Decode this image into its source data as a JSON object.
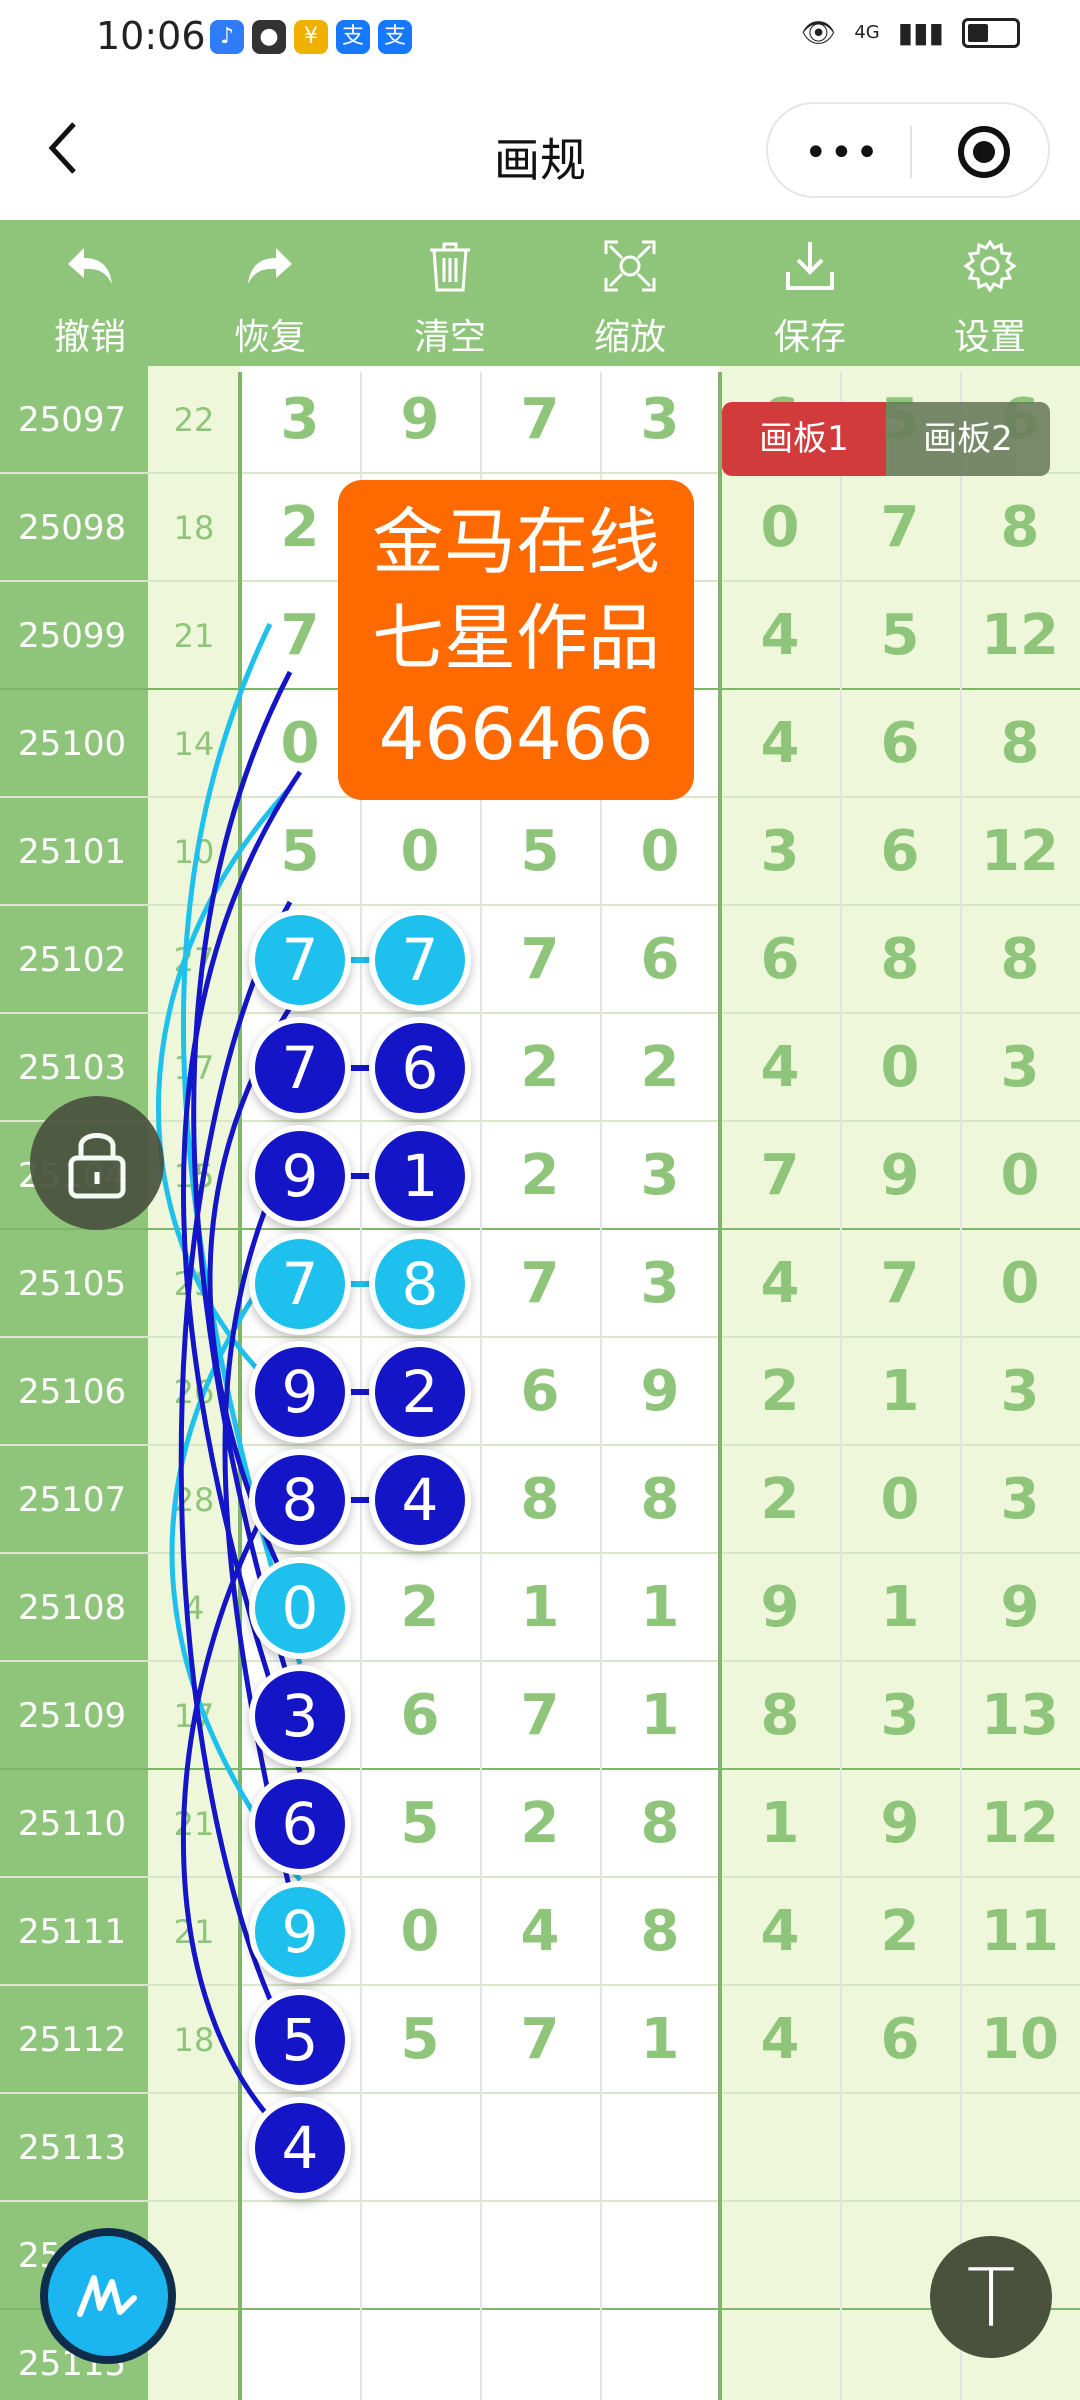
{
  "status_bar": {
    "time": "10:06",
    "network": "4G"
  },
  "header": {
    "title": "画规"
  },
  "toolbar": [
    {
      "label": "撤销",
      "icon": "undo-icon"
    },
    {
      "label": "恢复",
      "icon": "redo-icon"
    },
    {
      "label": "清空",
      "icon": "trash-icon"
    },
    {
      "label": "缩放",
      "icon": "zoom-icon"
    },
    {
      "label": "保存",
      "icon": "download-icon"
    },
    {
      "label": "设置",
      "icon": "gear-icon"
    }
  ],
  "tabs": {
    "board1": "画板1",
    "board2": "画板2"
  },
  "banner": {
    "line1": "金马在线",
    "line2": "七星作品",
    "line3": "466466"
  },
  "rows": [
    {
      "period": "25097",
      "sum": "22",
      "d": [
        "3",
        "9",
        "7",
        "3"
      ],
      "r": [
        "6",
        "5",
        "6"
      ]
    },
    {
      "period": "25098",
      "sum": "18",
      "d": [
        "2",
        "",
        "",
        ""
      ],
      "r": [
        "0",
        "7",
        "8"
      ]
    },
    {
      "period": "25099",
      "sum": "21",
      "d": [
        "7",
        "",
        "",
        ""
      ],
      "r": [
        "4",
        "5",
        "12"
      ]
    },
    {
      "period": "25100",
      "sum": "14",
      "d": [
        "0",
        "",
        "",
        ""
      ],
      "r": [
        "4",
        "6",
        "8"
      ]
    },
    {
      "period": "25101",
      "sum": "10",
      "d": [
        "5",
        "0",
        "5",
        "0"
      ],
      "r": [
        "3",
        "6",
        "12"
      ]
    },
    {
      "period": "25102",
      "sum": "27",
      "d": [
        "7",
        "7",
        "7",
        "6"
      ],
      "r": [
        "6",
        "8",
        "8"
      ]
    },
    {
      "period": "25103",
      "sum": "17",
      "d": [
        "7",
        "6",
        "2",
        "2"
      ],
      "r": [
        "4",
        "0",
        "3"
      ]
    },
    {
      "period": "25104",
      "sum": "15",
      "d": [
        "9",
        "1",
        "2",
        "3"
      ],
      "r": [
        "7",
        "9",
        "0"
      ]
    },
    {
      "period": "25105",
      "sum": "25",
      "d": [
        "7",
        "8",
        "7",
        "3"
      ],
      "r": [
        "4",
        "7",
        "0"
      ]
    },
    {
      "period": "25106",
      "sum": "26",
      "d": [
        "9",
        "2",
        "6",
        "9"
      ],
      "r": [
        "2",
        "1",
        "3"
      ]
    },
    {
      "period": "25107",
      "sum": "28",
      "d": [
        "8",
        "4",
        "8",
        "8"
      ],
      "r": [
        "2",
        "0",
        "3"
      ]
    },
    {
      "period": "25108",
      "sum": "4",
      "d": [
        "0",
        "2",
        "1",
        "1"
      ],
      "r": [
        "9",
        "1",
        "9"
      ]
    },
    {
      "period": "25109",
      "sum": "17",
      "d": [
        "3",
        "6",
        "7",
        "1"
      ],
      "r": [
        "8",
        "3",
        "13"
      ]
    },
    {
      "period": "25110",
      "sum": "21",
      "d": [
        "6",
        "5",
        "2",
        "8"
      ],
      "r": [
        "1",
        "9",
        "12"
      ]
    },
    {
      "period": "25111",
      "sum": "21",
      "d": [
        "9",
        "0",
        "4",
        "8"
      ],
      "r": [
        "4",
        "2",
        "11"
      ]
    },
    {
      "period": "25112",
      "sum": "18",
      "d": [
        "5",
        "5",
        "7",
        "1"
      ],
      "r": [
        "4",
        "6",
        "10"
      ]
    },
    {
      "period": "25113",
      "sum": "",
      "d": [
        "4",
        "",
        "",
        ""
      ],
      "r": [
        "",
        "",
        ""
      ]
    },
    {
      "period": "25114",
      "sum": "",
      "d": [
        "",
        "",
        "",
        ""
      ],
      "r": [
        "",
        "",
        ""
      ]
    },
    {
      "period": "25115",
      "sum": "",
      "d": [
        "",
        "",
        "",
        ""
      ],
      "r": [
        "",
        "",
        ""
      ]
    }
  ],
  "balls": [
    {
      "row": 5,
      "col": 0,
      "color": "cyan",
      "n": "7"
    },
    {
      "row": 5,
      "col": 1,
      "color": "cyan",
      "n": "7"
    },
    {
      "row": 6,
      "col": 0,
      "color": "blue",
      "n": "7"
    },
    {
      "row": 6,
      "col": 1,
      "color": "blue",
      "n": "6"
    },
    {
      "row": 7,
      "col": 0,
      "color": "blue",
      "n": "9"
    },
    {
      "row": 7,
      "col": 1,
      "color": "blue",
      "n": "1"
    },
    {
      "row": 8,
      "col": 0,
      "color": "cyan",
      "n": "7"
    },
    {
      "row": 8,
      "col": 1,
      "color": "cyan",
      "n": "8"
    },
    {
      "row": 9,
      "col": 0,
      "color": "blue",
      "n": "9"
    },
    {
      "row": 9,
      "col": 1,
      "color": "blue",
      "n": "2"
    },
    {
      "row": 10,
      "col": 0,
      "color": "blue",
      "n": "8"
    },
    {
      "row": 10,
      "col": 1,
      "color": "blue",
      "n": "4"
    },
    {
      "row": 11,
      "col": 0,
      "color": "cyan",
      "n": "0"
    },
    {
      "row": 12,
      "col": 0,
      "color": "blue",
      "n": "3"
    },
    {
      "row": 13,
      "col": 0,
      "color": "blue",
      "n": "6"
    },
    {
      "row": 14,
      "col": 0,
      "color": "cyan",
      "n": "9"
    },
    {
      "row": 15,
      "col": 0,
      "color": "blue",
      "n": "5"
    },
    {
      "row": 16,
      "col": 0,
      "color": "blue",
      "n": "4"
    }
  ],
  "colors": {
    "green": "#8fc57b",
    "light_green": "#eef7d9",
    "blue": "#1515c8",
    "cyan": "#1ec0ee",
    "orange": "#ff6a00",
    "red": "#d13b3b"
  }
}
